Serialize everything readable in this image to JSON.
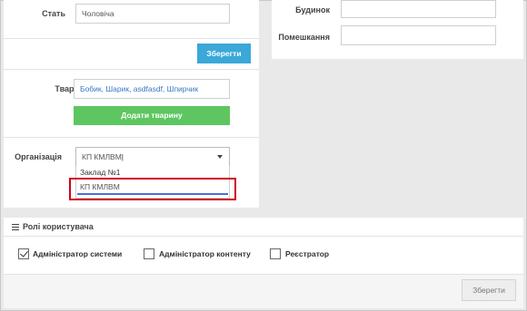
{
  "profile": {
    "gender_label": "Стать",
    "gender_value": "Чоловіча",
    "save_button": "Зберегти",
    "animals_label": "Тварини",
    "animals_value": "Бобик, Шарик, asdfasdf, Шпирчик",
    "add_animal_button": "Додати тварину",
    "organization_label": "Організація",
    "organization_value": "КП КМЛВМ",
    "organization_options": [
      "Заклад №1",
      "КП КМЛВМ"
    ]
  },
  "address": {
    "building_label": "Будинок",
    "room_label": "Помешкання"
  },
  "roles": {
    "section_title": "Ролі користувача",
    "items": [
      {
        "label": "Адміністратор системи",
        "checked": true
      },
      {
        "label": "Адміністратор контенту",
        "checked": false
      },
      {
        "label": "Реєстратор",
        "checked": false
      }
    ],
    "save_button": "Зберегти"
  },
  "colors": {
    "save_blue": "#3aa8d8",
    "add_green": "#5dc660",
    "highlight_red": "#d0021b",
    "input_accent": "#4a6fd8"
  }
}
